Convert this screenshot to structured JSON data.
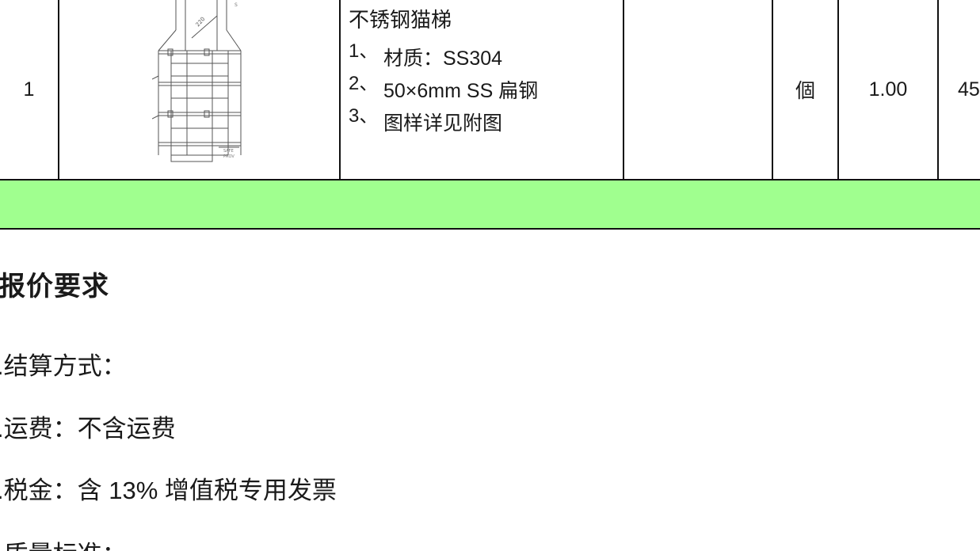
{
  "table": {
    "row": {
      "number": "1",
      "drawing_text_top": "S",
      "drawing_text_bottom_1": "SAFE",
      "drawing_text_bottom_2": "PROV",
      "drawing_dim": "220",
      "title": "不锈钢猫梯",
      "specs": [
        {
          "num": "1、",
          "text": "材质：SS304"
        },
        {
          "num": "2、",
          "text": "50×6mm SS 扁钢"
        },
        {
          "num": "3、",
          "text": "图样详见附图"
        }
      ],
      "spec_col": "",
      "unit": "個",
      "quantity": "1.00",
      "price_partial": "45"
    },
    "total_row_color": "#a0ff8f"
  },
  "requirements": {
    "heading": "报价要求",
    "items": [
      ".结算方式：",
      ".运费：不含运费",
      ".税金：含 13% 增值税专用发票",
      ".质量标准："
    ]
  }
}
